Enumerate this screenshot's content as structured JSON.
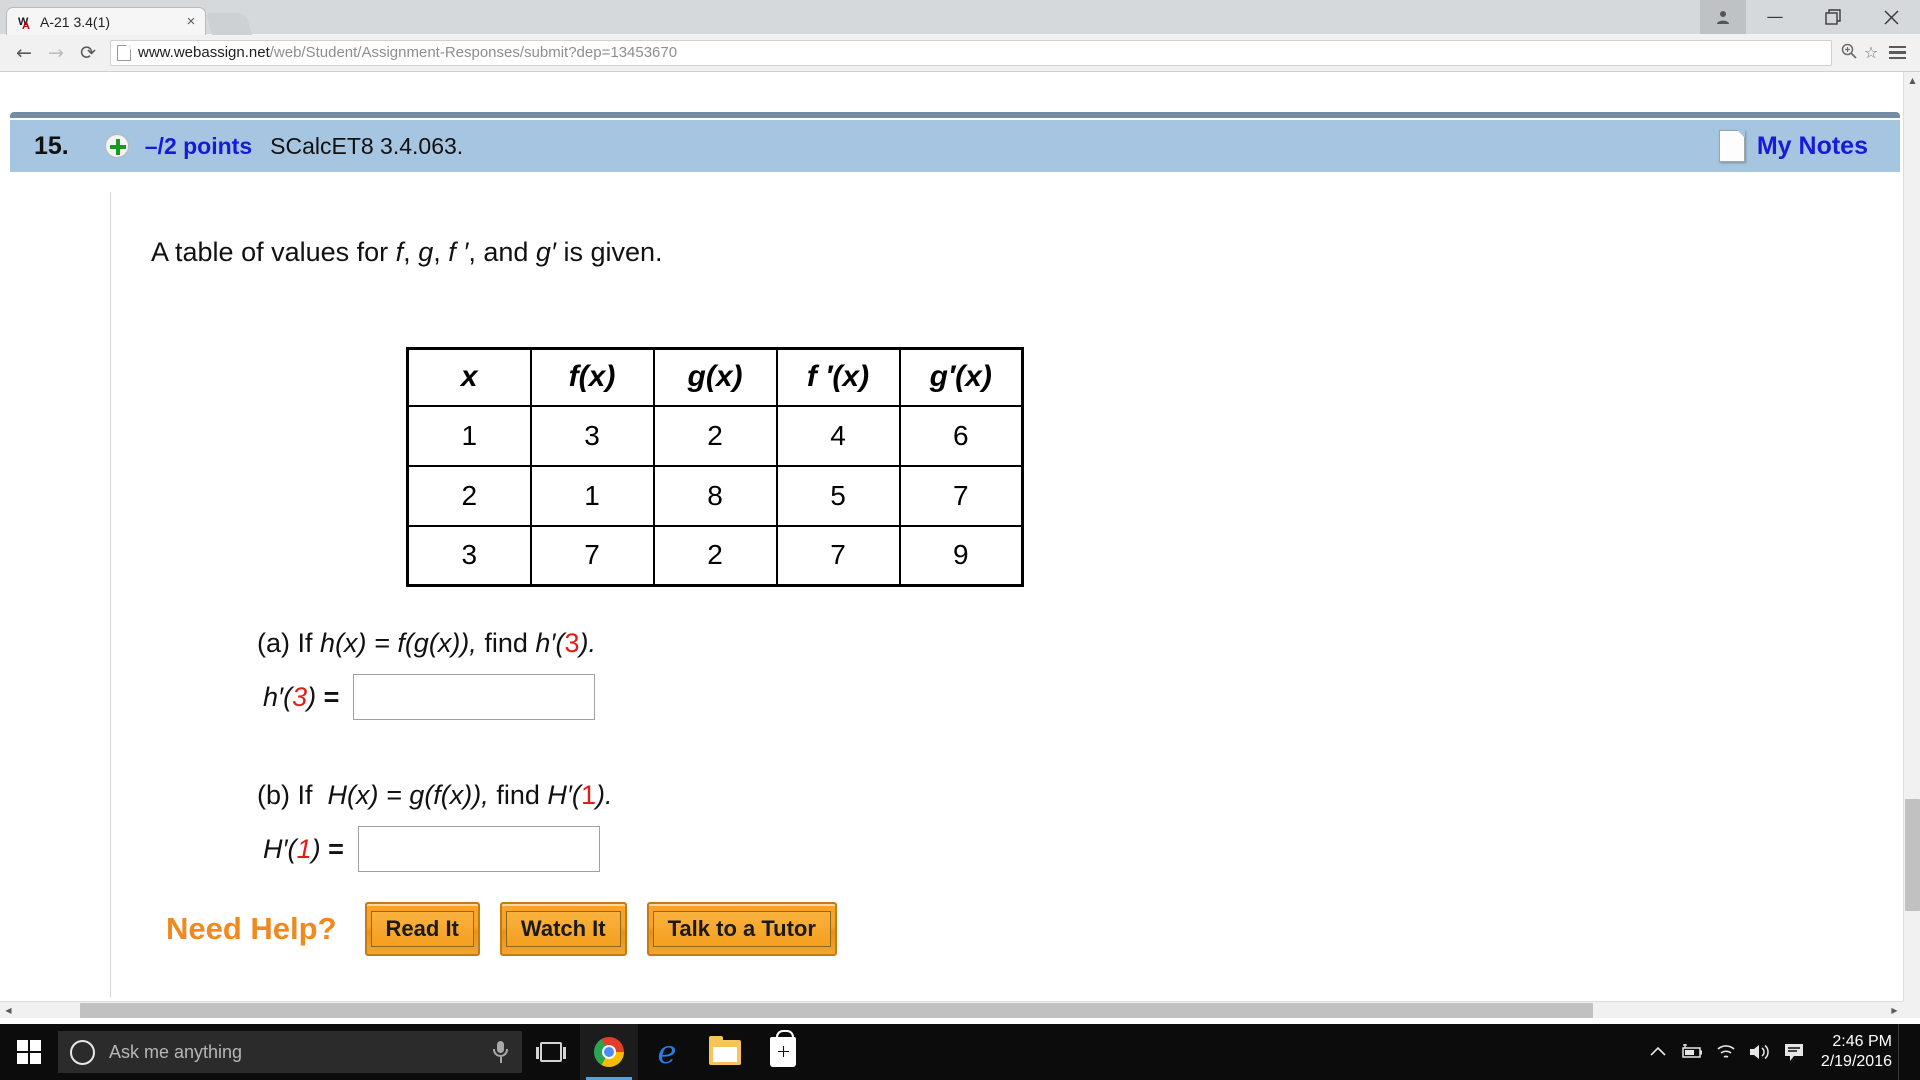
{
  "browser": {
    "tab": {
      "favicon": "webassign-wa-favicon",
      "title": "A-21 3.4(1)",
      "close_glyph": "×"
    },
    "window_controls": {
      "profile_glyph": "👤",
      "minimize_glyph": "—",
      "maximize_glyph": "❐",
      "close_glyph": "✕"
    },
    "toolbar": {
      "back_glyph": "←",
      "forward_glyph": "→",
      "reload_glyph": "⟳",
      "url_host": "www.webassign.net",
      "url_path": "/web/Student/Assignment-Responses/submit?dep=13453670",
      "zoom_glyph": "⊕",
      "bookmark_glyph": "☆"
    }
  },
  "question": {
    "number": "15.",
    "points": "–/2 points",
    "code": "SCalcET8 3.4.063.",
    "my_notes_label": "My Notes",
    "prompt_parts": {
      "a": "A table of values for ",
      "f": "f",
      "c1": ", ",
      "g": "g",
      "c2": ", ",
      "fp": "f ′",
      "c3": ", and ",
      "gp": "g′",
      "end": " is given."
    }
  },
  "table": {
    "headers": [
      "x",
      "f(x)",
      "g(x)",
      "f ′(x)",
      "g′(x)"
    ],
    "rows": [
      [
        "1",
        "3",
        "2",
        "4",
        "6"
      ],
      [
        "2",
        "1",
        "8",
        "5",
        "7"
      ],
      [
        "3",
        "7",
        "2",
        "7",
        "9"
      ]
    ]
  },
  "parts": [
    {
      "marker": "(a)",
      "if_word": "If",
      "definition": "h(x) = f(g(x)),",
      "find_word": "find",
      "target_fn": "h′(",
      "target_arg": "3",
      "target_close": ").",
      "answer_label_fn": "h′(",
      "answer_label_arg": "3",
      "answer_label_close": ")",
      "answer_eq": "=",
      "answer_value": "",
      "answer_placeholder": ""
    },
    {
      "marker": "(b)",
      "if_word": "If",
      "definition": "H(x) = g(f(x)),",
      "find_word": "find",
      "target_fn": "H′(",
      "target_arg": "1",
      "target_close": ").",
      "answer_label_fn": "H′(",
      "answer_label_arg": "1",
      "answer_label_close": ")",
      "answer_eq": "=",
      "answer_value": "",
      "answer_placeholder": ""
    }
  ],
  "need_help": {
    "label": "Need Help?",
    "buttons": [
      "Read It",
      "Watch It",
      "Talk to a Tutor"
    ]
  },
  "taskbar": {
    "start_label": "windows-start",
    "search_placeholder": "Ask me anything",
    "icons": [
      "task-view",
      "google-chrome",
      "microsoft-edge",
      "file-explorer",
      "windows-store"
    ],
    "tray": {
      "chevron_glyph": "∧",
      "battery_glyph": "🔋",
      "wifi_glyph": "📶",
      "volume_glyph": "🔊",
      "action_center_glyph": "💬",
      "time": "2:46 PM",
      "date": "2/19/2016"
    }
  },
  "colors": {
    "banner_blue": "#a5c5e0",
    "link_blue": "#1919d8",
    "accent_red": "#e41b17",
    "help_orange": "#f08a1e",
    "button_orange": "#f7a428"
  }
}
